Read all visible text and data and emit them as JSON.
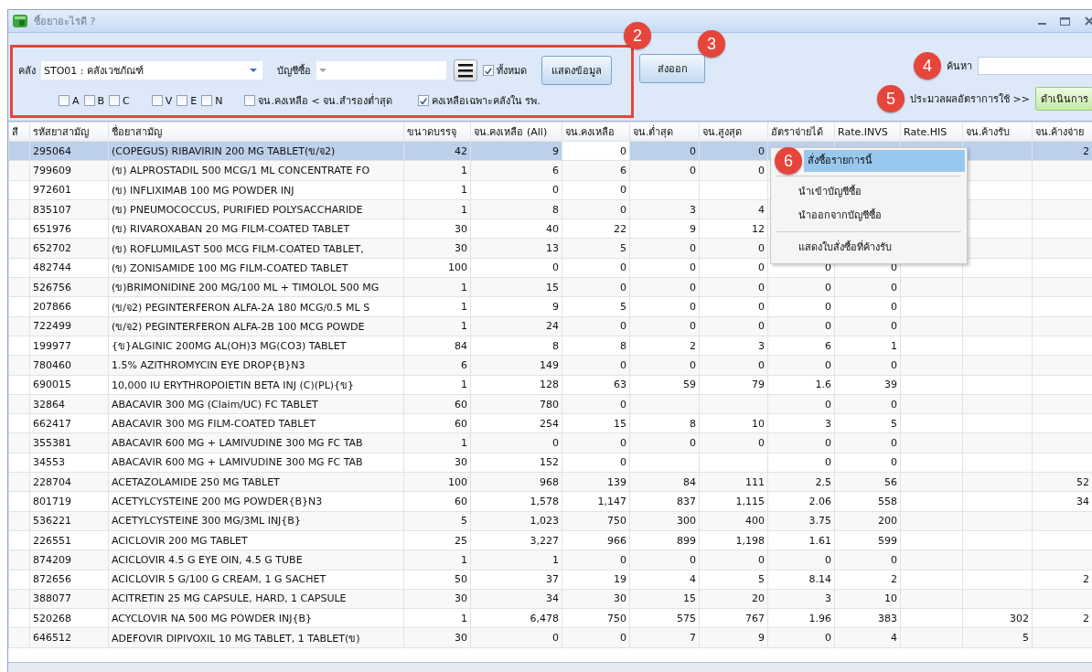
{
  "window": {
    "title": "ซื้อยาอะไรดี ?"
  },
  "filters": {
    "badge": "2",
    "warehouse": {
      "label": "คลัง",
      "value": "STO01 : คลังเวชภัณฑ์"
    },
    "purchase_list": {
      "label": "บัญชีซื้อ"
    },
    "all": {
      "label": "ทั้งหมด",
      "checked": true
    },
    "show_button": "แสดงข้อมูล",
    "abc_checks": [
      {
        "label": "A",
        "checked": false
      },
      {
        "label": "B",
        "checked": false
      },
      {
        "label": "C",
        "checked": false
      }
    ],
    "ven_checks": [
      {
        "label": "V",
        "checked": false
      },
      {
        "label": "E",
        "checked": false
      },
      {
        "label": "N",
        "checked": false
      }
    ],
    "options": [
      {
        "label": "จน.คงเหลือ < จน.สำรองต่ำสุด",
        "checked": false
      },
      {
        "label": "คงเหลือเฉพาะคลังใน รพ.",
        "checked": true
      }
    ]
  },
  "export_button": {
    "label": "ส่งออก",
    "badge": "3"
  },
  "search": {
    "badge": "4",
    "label": "ค้นหา"
  },
  "process": {
    "badge": "5",
    "label": "ประมวลผลอัตราการใช้ >>",
    "button": "ดำเนินการ"
  },
  "table": {
    "columns": [
      {
        "label": "สี"
      },
      {
        "label": "รหัสยาสามัญ"
      },
      {
        "label": "ชื่อยาสามัญ"
      },
      {
        "label": "ขนาดบรรจุ"
      },
      {
        "label": "จน.คงเหลือ (All)"
      },
      {
        "label": "จน.คงเหลือ"
      },
      {
        "label": "จน.ต่ำสุด"
      },
      {
        "label": "จน.สูงสุด"
      },
      {
        "label": "อัตราจ่ายได้"
      },
      {
        "label": "Rate.INVS"
      },
      {
        "label": "Rate.HIS"
      },
      {
        "label": "จน.ค้างรับ"
      },
      {
        "label": "จน.ค้างจ่าย"
      }
    ],
    "rows": [
      {
        "selected": true,
        "cells": [
          null,
          "295064",
          "(COPEGUS) RIBAVIRIN 200 MG TABLET(ข/จ2)",
          "42",
          "9",
          "0",
          "0",
          "0",
          null,
          null,
          null,
          null,
          "2"
        ]
      },
      {
        "selected": false,
        "cells": [
          null,
          "799609",
          "(ข) ALPROSTADIL 500 MCG/1 ML CONCENTRATE FO",
          "1",
          "6",
          "6",
          "0",
          "0",
          null,
          null,
          null,
          null,
          null
        ]
      },
      {
        "selected": false,
        "cells": [
          null,
          "972601",
          "(ข) INFLIXIMAB 100 MG POWDER INJ",
          "1",
          "0",
          "0",
          null,
          null,
          null,
          null,
          null,
          null,
          null
        ]
      },
      {
        "selected": false,
        "cells": [
          null,
          "835107",
          "(ข) PNEUMOCOCCUS, PURIFIED POLYSACCHARIDE",
          "1",
          "8",
          "0",
          "3",
          "4",
          null,
          null,
          null,
          null,
          null
        ]
      },
      {
        "selected": false,
        "cells": [
          null,
          "651976",
          "(ข) RIVAROXABAN 20 MG FILM-COATED TABLET",
          "30",
          "40",
          "22",
          "9",
          "12",
          null,
          null,
          null,
          null,
          null
        ]
      },
      {
        "selected": false,
        "cells": [
          null,
          "652702",
          "(ข) ROFLUMILAST 500 MCG FILM-COATED TABLET,",
          "30",
          "13",
          "5",
          "0",
          "0",
          null,
          null,
          null,
          null,
          null
        ]
      },
      {
        "selected": false,
        "cells": [
          null,
          "482744",
          "(ข) ZONISAMIDE 100 MG FILM-COATED TABLET",
          "100",
          "0",
          "0",
          "0",
          "0",
          "0",
          "0",
          null,
          null,
          null
        ]
      },
      {
        "selected": false,
        "cells": [
          null,
          "526756",
          "(ข)BRIMONIDINE 200 MG/100 ML + TIMOLOL 500 MG",
          "1",
          "15",
          "0",
          "0",
          "0",
          "0",
          "0",
          null,
          null,
          null
        ]
      },
      {
        "selected": false,
        "cells": [
          null,
          "207866",
          "(ข/จ2) PEGINTERFERON ALFA-2A 180 MCG/0.5 ML S",
          "1",
          "9",
          "5",
          "0",
          "0",
          "0",
          "0",
          null,
          null,
          null
        ]
      },
      {
        "selected": false,
        "cells": [
          null,
          "722499",
          "(ข/จ2) PEGINTERFERON ALFA-2B 100 MCG POWDE",
          "1",
          "24",
          "0",
          "0",
          "0",
          "0",
          "0",
          null,
          null,
          null
        ]
      },
      {
        "selected": false,
        "cells": [
          null,
          "199977",
          "{ข}ALGINIC 200MG AL(OH)3 MG(CO3) TABLET",
          "84",
          "8",
          "8",
          "2",
          "3",
          "6",
          "1",
          null,
          null,
          null
        ]
      },
      {
        "selected": false,
        "cells": [
          null,
          "780460",
          "1.5% AZITHROMYCIN EYE DROP{B}N3",
          "6",
          "149",
          "0",
          "0",
          "0",
          "0",
          "0",
          null,
          null,
          null
        ]
      },
      {
        "selected": false,
        "cells": [
          null,
          "690015",
          "10,000 IU ERYTHROPOIETIN BETA INJ (C)(PL){ข}",
          "1",
          "128",
          "63",
          "59",
          "79",
          "1.6",
          "39",
          null,
          null,
          null
        ]
      },
      {
        "selected": false,
        "cells": [
          null,
          "32864",
          "ABACAVIR 300 MG (Claim/UC) FC TABLET",
          "60",
          "780",
          "0",
          null,
          null,
          "0",
          "0",
          null,
          null,
          null
        ]
      },
      {
        "selected": false,
        "cells": [
          null,
          "662417",
          "ABACAVIR 300 MG FILM-COATED TABLET",
          "60",
          "254",
          "15",
          "8",
          "10",
          "3",
          "5",
          null,
          null,
          null
        ]
      },
      {
        "selected": false,
        "cells": [
          null,
          "355381",
          "ABACAVIR 600 MG + LAMIVUDINE 300 MG FC TAB",
          "1",
          "0",
          "0",
          "0",
          "0",
          "0",
          "0",
          null,
          null,
          null
        ]
      },
      {
        "selected": false,
        "cells": [
          null,
          "34553",
          "ABACAVIR 600 MG + LAMIVUDINE 300 MG FC TAB",
          "30",
          "152",
          "0",
          null,
          null,
          "0",
          "0",
          null,
          null,
          null
        ]
      },
      {
        "selected": false,
        "cells": [
          null,
          "228704",
          "ACETAZOLAMIDE 250 MG TABLET",
          "100",
          "968",
          "139",
          "84",
          "111",
          "2.5",
          "56",
          null,
          null,
          "52"
        ]
      },
      {
        "selected": false,
        "cells": [
          null,
          "801719",
          "ACETYLCYSTEINE 200 MG POWDER{B}N3",
          "60",
          "1,578",
          "1,147",
          "837",
          "1,115",
          "2.06",
          "558",
          null,
          null,
          "34"
        ]
      },
      {
        "selected": false,
        "cells": [
          null,
          "536221",
          "ACETYLCYSTEINE 300 MG/3ML INJ{B}",
          "5",
          "1,023",
          "750",
          "300",
          "400",
          "3.75",
          "200",
          null,
          null,
          null
        ]
      },
      {
        "selected": false,
        "cells": [
          null,
          "226551",
          "ACICLOVIR 200 MG TABLET",
          "25",
          "3,227",
          "966",
          "899",
          "1,198",
          "1.61",
          "599",
          null,
          null,
          null
        ]
      },
      {
        "selected": false,
        "cells": [
          null,
          "874209",
          "ACICLOVIR 4.5 G EYE OIN, 4.5 G TUBE",
          "1",
          "1",
          "0",
          "0",
          "0",
          "0",
          "0",
          null,
          null,
          null
        ]
      },
      {
        "selected": false,
        "cells": [
          null,
          "872656",
          "ACICLOVIR 5 G/100 G CREAM, 1 G SACHET",
          "50",
          "37",
          "19",
          "4",
          "5",
          "8.14",
          "2",
          null,
          null,
          "2"
        ]
      },
      {
        "selected": false,
        "cells": [
          null,
          "388077",
          "ACITRETIN 25 MG CAPSULE, HARD, 1 CAPSULE",
          "30",
          "34",
          "30",
          "15",
          "20",
          "3",
          "10",
          null,
          null,
          null
        ]
      },
      {
        "selected": false,
        "cells": [
          null,
          "520268",
          "ACYCLOVIR NA 500 MG POWDER INJ{B}",
          "1",
          "6,478",
          "750",
          "575",
          "767",
          "1.96",
          "383",
          null,
          "302",
          "2"
        ]
      },
      {
        "selected": false,
        "cells": [
          null,
          "646512",
          "ADEFOVIR DIPIVOXIL 10 MG TABLET, 1 TABLET(ข)",
          "30",
          "0",
          "0",
          "7",
          "9",
          "0",
          "4",
          null,
          "5",
          null
        ]
      }
    ]
  },
  "context_menu": {
    "items": [
      {
        "kind": "item",
        "label": "สั่งซื้อรายการนี้",
        "selected": true,
        "badge": "6"
      },
      {
        "kind": "separator"
      },
      {
        "kind": "item",
        "label": "นำเข้าบัญชีซื้อ",
        "selected": false
      },
      {
        "kind": "item",
        "label": "นำออกจากบัญชีซื้อ",
        "selected": false
      },
      {
        "kind": "separator"
      },
      {
        "kind": "item",
        "label": "แสดงใบสั่งซื้อที่ค้างรับ",
        "selected": false
      }
    ]
  }
}
